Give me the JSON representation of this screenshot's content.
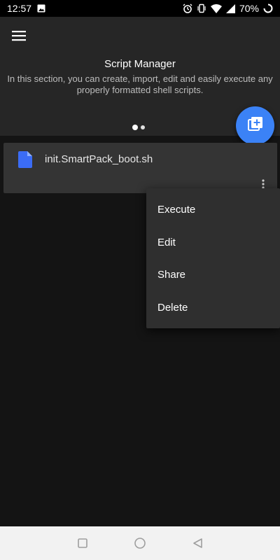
{
  "status_bar": {
    "time": "12:57",
    "battery_text": "70%",
    "icons": [
      "image-notification-icon",
      "alarm-icon",
      "vibrate-icon",
      "wifi-icon",
      "signal-icon",
      "battery-icon"
    ]
  },
  "header": {
    "menu_icon": "hamburger-menu-icon",
    "title": "Script Manager",
    "description": "In this section, you can create, import, edit and easily execute any properly formatted shell scripts."
  },
  "pager": {
    "pages": 2,
    "active_index": 0
  },
  "fab": {
    "icon": "add-library-icon",
    "color": "#3b82f6"
  },
  "scripts": [
    {
      "name": "init.SmartPack_boot.sh",
      "icon": "file-icon",
      "icon_color": "#3b6cf5"
    }
  ],
  "context_menu": {
    "items": [
      {
        "label": "Execute"
      },
      {
        "label": "Edit"
      },
      {
        "label": "Share"
      },
      {
        "label": "Delete"
      }
    ]
  },
  "nav_bar": {
    "buttons": [
      "recents-square-icon",
      "home-circle-icon",
      "back-triangle-icon"
    ]
  }
}
